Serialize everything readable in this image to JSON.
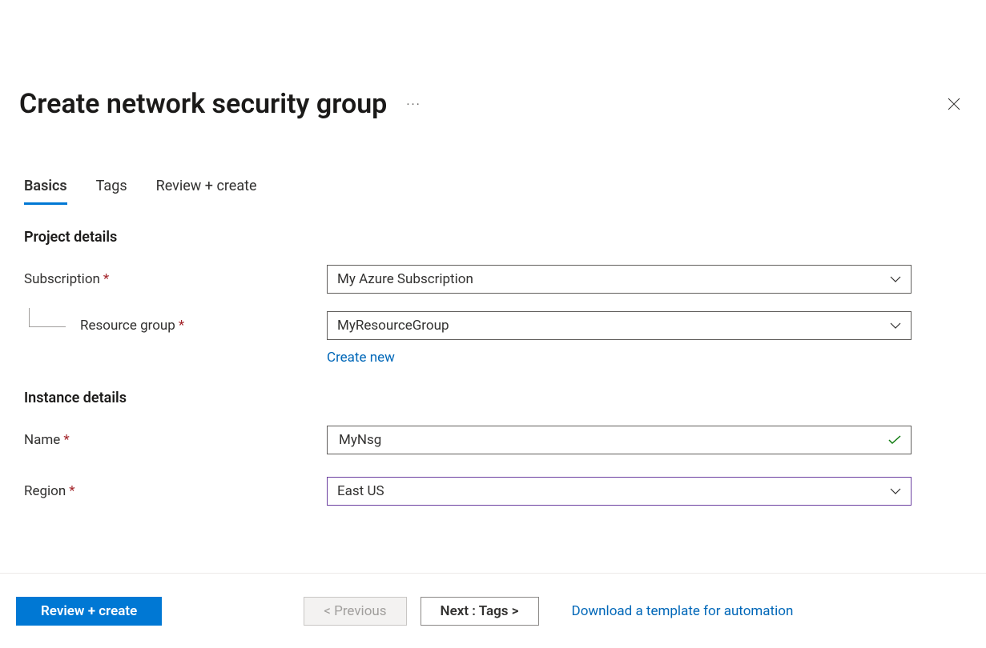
{
  "header": {
    "title": "Create network security group"
  },
  "tabs": {
    "basics": "Basics",
    "tags": "Tags",
    "review": "Review + create"
  },
  "sections": {
    "project_details": "Project details",
    "instance_details": "Instance details"
  },
  "form": {
    "subscription_label": "Subscription",
    "subscription_value": "My Azure Subscription",
    "resource_group_label": "Resource group",
    "resource_group_value": "MyResourceGroup",
    "create_new": "Create new",
    "name_label": "Name",
    "name_value": "MyNsg",
    "region_label": "Region",
    "region_value": "East US"
  },
  "footer": {
    "review_create": "Review + create",
    "previous": "< Previous",
    "next": "Next : Tags >",
    "download_template": "Download a template for automation"
  }
}
